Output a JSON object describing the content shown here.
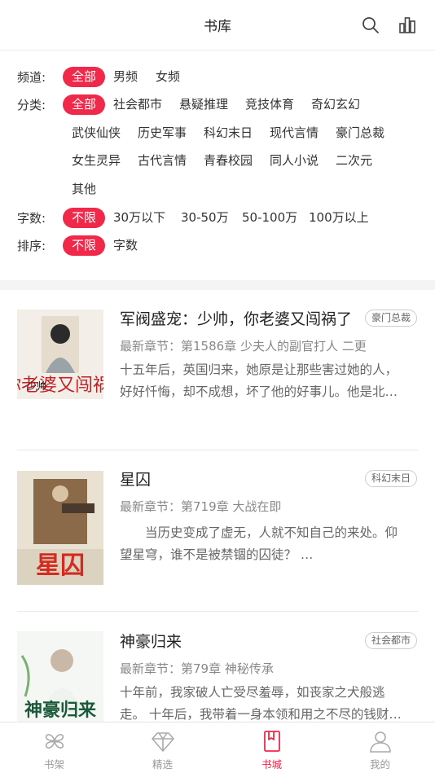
{
  "header": {
    "title": "书库",
    "search_icon": "search-icon",
    "rank_icon": "ranking-chart-icon"
  },
  "filters": {
    "channel": {
      "label": "频道:",
      "options": [
        "全部",
        "男频",
        "女频"
      ],
      "selected": "全部"
    },
    "category": {
      "label": "分类:",
      "options": [
        "全部",
        "社会都市",
        "悬疑推理",
        "竞技体育",
        "奇幻玄幻",
        "武侠仙侠",
        "历史军事",
        "科幻末日",
        "现代言情",
        "豪门总裁",
        "女生灵异",
        "古代言情",
        "青春校园",
        "同人小说",
        "二次元",
        "其他"
      ],
      "selected": "全部"
    },
    "words": {
      "label": "字数:",
      "options": [
        "不限",
        "30万以下",
        "30-50万",
        "50-100万",
        "100万以上"
      ],
      "selected": "不限"
    },
    "sort": {
      "label": "排序:",
      "options": [
        "不限",
        "字数"
      ],
      "selected": "不限"
    }
  },
  "books": [
    {
      "title": "军阀盛宠：少帅，你老婆又闯祸了",
      "tag": "豪门总裁",
      "latest": "最新章节：第1586章 少夫人的副官打人 二更",
      "desc": "十五年后，英国归来，她原是让那些害过她的人，好好忏悔，却不成想，坏了他的好事儿。他是北…",
      "cover_text": "你老婆又闯祸了",
      "cover_sub": "少帅"
    },
    {
      "title": "星囚",
      "tag": "科幻末日",
      "latest": "最新章节：第719章 大战在即",
      "desc": "当历史变成了虚无，人就不知自己的来处。仰望星穹，谁不是被禁锢的囚徒？ …",
      "cover_text": "星囚"
    },
    {
      "title": "神豪归来",
      "tag": "社会都市",
      "latest": "最新章节：第79章 神秘传承",
      "desc": "十年前，我家破人亡受尽羞辱，如丧家之犬般逃走。 十年后，我带着一身本领和用之不尽的钱财…",
      "cover_text": "神豪归来"
    }
  ],
  "tabbar": [
    {
      "label": "书架",
      "icon": "bookshelf-icon",
      "active": false
    },
    {
      "label": "精选",
      "icon": "diamond-icon",
      "active": false
    },
    {
      "label": "书城",
      "icon": "bookstore-icon",
      "active": true
    },
    {
      "label": "我的",
      "icon": "profile-icon",
      "active": false
    }
  ],
  "colors": {
    "accent": "#f0284a"
  }
}
